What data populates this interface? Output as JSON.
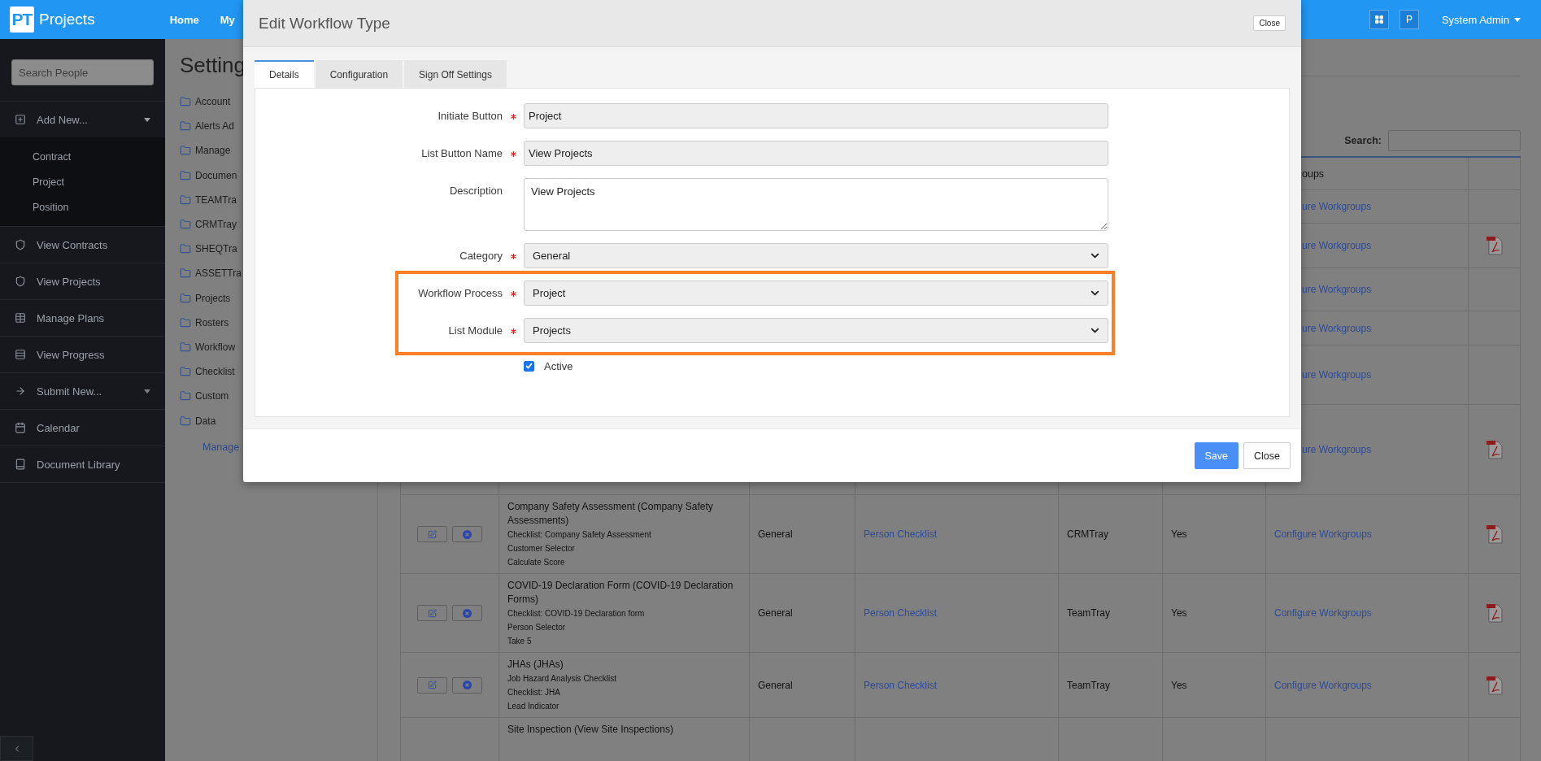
{
  "topbar": {
    "logo_mark": "PT",
    "app_name": "Projects",
    "nav": [
      "Home",
      "My"
    ],
    "user_initial": "P",
    "user_name": "System Admin"
  },
  "sidebar": {
    "search_placeholder": "Search People",
    "items": [
      {
        "label": "Add New...",
        "expanded": true,
        "children": [
          {
            "label": "Contract"
          },
          {
            "label": "Project"
          },
          {
            "label": "Position"
          }
        ]
      },
      {
        "label": "View Contracts"
      },
      {
        "label": "View Projects"
      },
      {
        "label": "Manage Plans"
      },
      {
        "label": "View Progress"
      },
      {
        "label": "Submit New...",
        "expanded": false
      },
      {
        "label": "Calendar"
      },
      {
        "label": "Document Library"
      }
    ]
  },
  "settings": {
    "title": "Setting",
    "folders": [
      "Account",
      "Alerts Ad",
      "Manage",
      "Documen",
      "TEAMTra",
      "CRMTray",
      "SHEQTra",
      "ASSETTra",
      "Projects",
      "Rosters",
      "Workflow",
      "Checklist",
      "Custom",
      "Data"
    ],
    "link": "Manage"
  },
  "table": {
    "search_label": "Search:",
    "column_7_header": "oups",
    "covered_rows": [
      {
        "workgroups": "ure Workgroups",
        "pdf": false
      },
      {
        "workgroups": "ure Workgroups",
        "pdf": true
      },
      {
        "workgroups": "ure Workgroups",
        "pdf": false
      },
      {
        "workgroups": "ure Workgroups",
        "pdf": false
      },
      {
        "workgroups": "ure Workgroups",
        "pdf": false
      },
      {
        "workgroups": "ure Workgroups",
        "pdf": true
      }
    ],
    "rows": [
      {
        "title": "Company Safety Assessment (Company Safety Assessments)",
        "details": [
          "Checklist: Company Safety Assessment",
          "Customer Selector",
          "Calculate Score"
        ],
        "category": "General",
        "type": "Person Checklist",
        "tray": "CRMTray",
        "enabled": "Yes",
        "workgroups": "Configure Workgroups",
        "pdf": true
      },
      {
        "title": "COVID-19 Declaration Form (COVID-19 Declaration Forms)",
        "details": [
          "Checklist: COVID-19 Declaration form",
          "Person Selector",
          "Take 5"
        ],
        "category": "General",
        "type": "Person Checklist",
        "tray": "TeamTray",
        "enabled": "Yes",
        "workgroups": "Configure Workgroups",
        "pdf": true
      },
      {
        "title": "JHAs (JHAs)",
        "details": [
          "Job Hazard Analysis Checklist",
          "Checklist: JHA",
          "Lead Indicator"
        ],
        "category": "General",
        "type": "Person Checklist",
        "tray": "TeamTray",
        "enabled": "Yes",
        "workgroups": "Configure Workgroups",
        "pdf": true
      },
      {
        "title": "Site Inspection (View Site Inspections)"
      }
    ]
  },
  "modal": {
    "title": "Edit Workflow Type",
    "close_label": "Close",
    "tabs": [
      {
        "label": "Details",
        "selected": true
      },
      {
        "label": "Configuration",
        "selected": false
      },
      {
        "label": "Sign Off Settings",
        "selected": false
      }
    ],
    "fields": [
      {
        "label": "Initiate Button",
        "required": true,
        "kind": "text",
        "value": "Project",
        "highlighted": false
      },
      {
        "label": "List Button Name",
        "required": true,
        "kind": "text",
        "value": "View Projects",
        "highlighted": false
      },
      {
        "label": "Description",
        "required": false,
        "kind": "textarea",
        "value": "View Projects",
        "highlighted": false
      },
      {
        "label": "Category",
        "required": true,
        "kind": "select",
        "value": "General",
        "highlighted": false
      },
      {
        "label": "Workflow Process",
        "required": true,
        "kind": "select",
        "value": "Project",
        "highlighted": true
      },
      {
        "label": "List Module",
        "required": true,
        "kind": "select",
        "value": "Projects",
        "highlighted": true
      }
    ],
    "active": {
      "label": "Active",
      "checked": true
    },
    "buttons": [
      {
        "label": "Save",
        "kind": "primary"
      },
      {
        "label": "Close",
        "kind": "default"
      }
    ]
  }
}
